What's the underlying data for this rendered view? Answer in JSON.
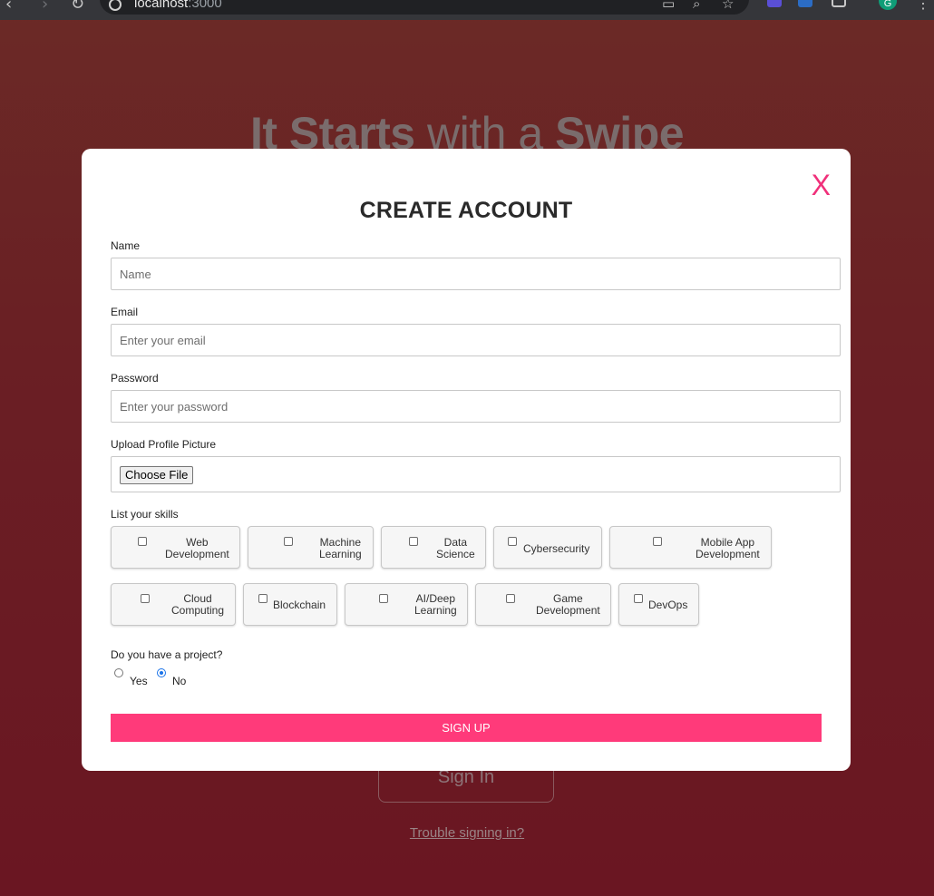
{
  "browser": {
    "url_host": "localhost",
    "url_port": ":3000",
    "profile_initial": "G"
  },
  "background": {
    "hero_part1": "It Starts",
    "hero_part2": "with a",
    "hero_part3": "Swipe",
    "signin_label": "Sign In",
    "trouble_label": "Trouble signing in?"
  },
  "modal": {
    "close_label": "X",
    "title": "CREATE ACCOUNT",
    "name": {
      "label": "Name",
      "placeholder": "Name"
    },
    "email": {
      "label": "Email",
      "placeholder": "Enter your email"
    },
    "password": {
      "label": "Password",
      "placeholder": "Enter your password"
    },
    "upload": {
      "label": "Upload Profile Picture",
      "button": "Choose File"
    },
    "skills_label": "List your skills",
    "skills": [
      {
        "l1": "Web",
        "l2": "Development"
      },
      {
        "l1": "Machine",
        "l2": "Learning"
      },
      {
        "l1": "Data",
        "l2": "Science"
      },
      {
        "l1": "Cybersecurity",
        "l2": ""
      },
      {
        "l1": "Mobile App",
        "l2": "Development"
      },
      {
        "l1": "Cloud",
        "l2": "Computing"
      },
      {
        "l1": "Blockchain",
        "l2": ""
      },
      {
        "l1": "AI/Deep",
        "l2": "Learning"
      },
      {
        "l1": "Game",
        "l2": "Development"
      },
      {
        "l1": "DevOps",
        "l2": ""
      }
    ],
    "project_question": "Do you have a project?",
    "project_options": [
      "Yes",
      "No"
    ],
    "project_selected": "No",
    "signup_label": "SIGN UP"
  },
  "colors": {
    "accent": "#ff3a7a",
    "close": "#f0307a",
    "radio_selected": "#1a73e8"
  }
}
